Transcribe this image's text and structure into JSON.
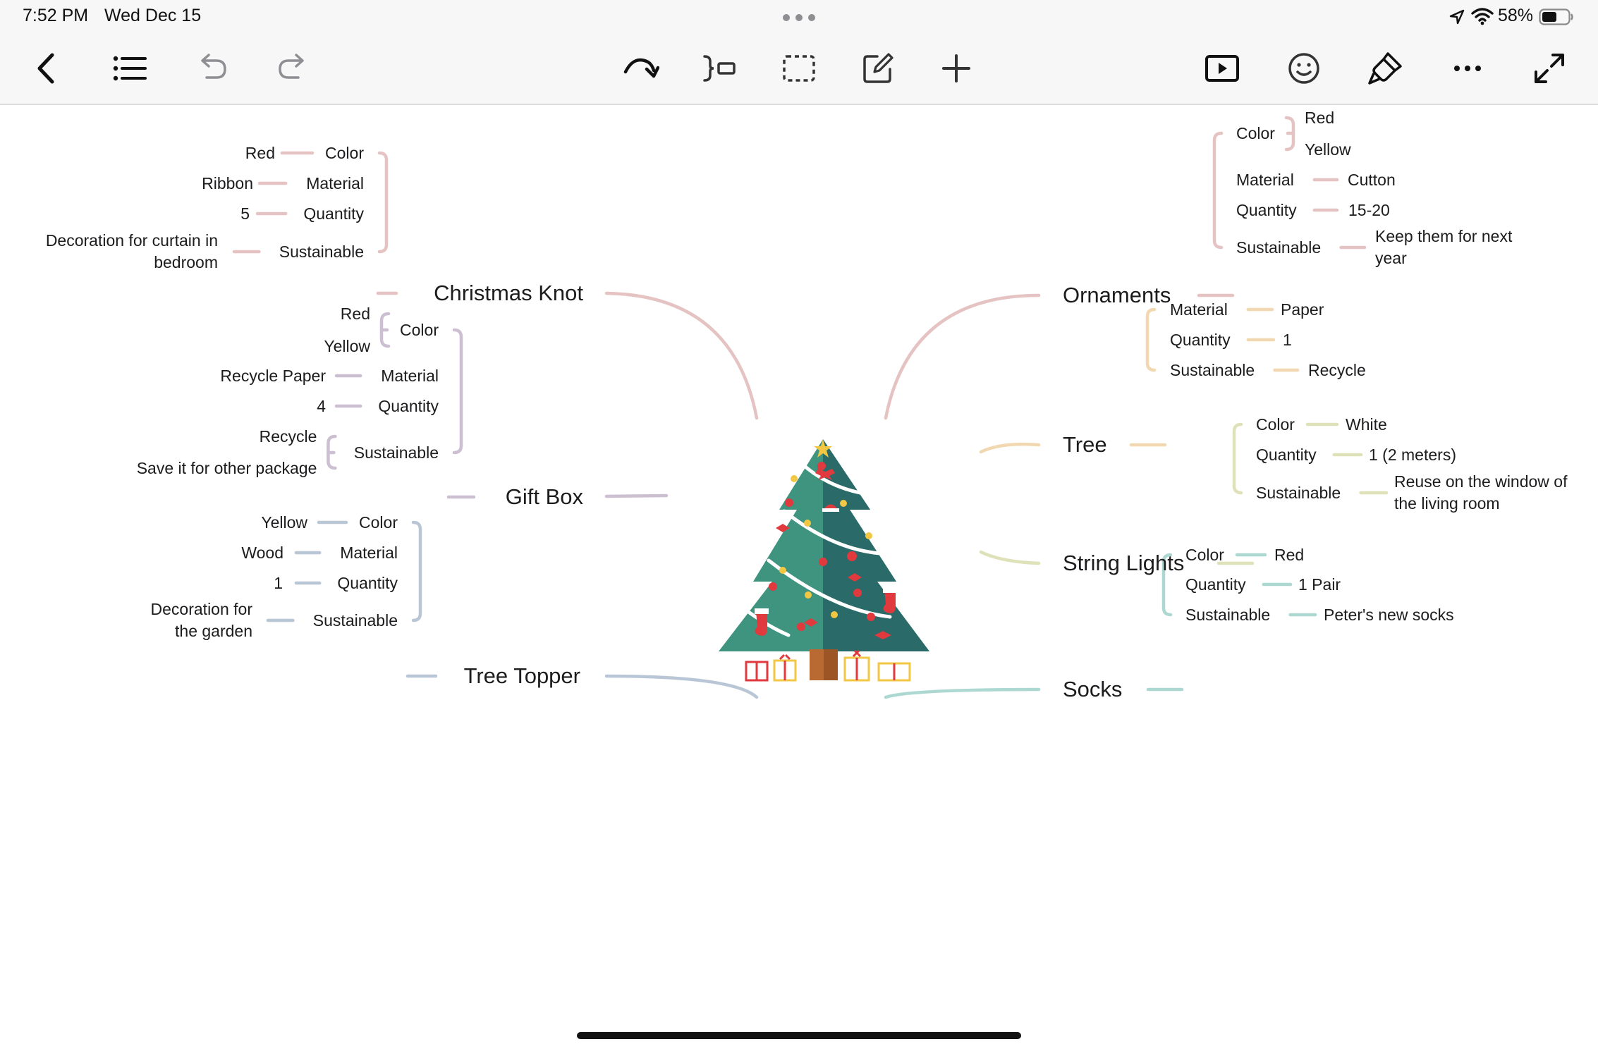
{
  "status_bar": {
    "time": "7:52 PM",
    "date": "Wed Dec 15",
    "battery": "58%",
    "battery_level": 0.58
  },
  "toolbar": {
    "left": [
      {
        "name": "back-button",
        "icon": "chevron-left-icon"
      },
      {
        "name": "outline-button",
        "icon": "list-icon"
      },
      {
        "name": "undo-button",
        "icon": "undo-icon"
      },
      {
        "name": "redo-button",
        "icon": "redo-icon"
      }
    ],
    "center": [
      {
        "name": "relationship-button",
        "icon": "curved-arrow-icon"
      },
      {
        "name": "summary-button",
        "icon": "summary-bracket-icon"
      },
      {
        "name": "boundary-button",
        "icon": "dashed-rect-icon"
      },
      {
        "name": "note-button",
        "icon": "edit-note-icon"
      },
      {
        "name": "add-topic-button",
        "icon": "plus-icon"
      }
    ],
    "right": [
      {
        "name": "play-button",
        "icon": "play-icon"
      },
      {
        "name": "sticker-button",
        "icon": "smiley-icon"
      },
      {
        "name": "format-button",
        "icon": "brush-icon"
      },
      {
        "name": "more-button",
        "icon": "more-icon"
      },
      {
        "name": "fullscreen-button",
        "icon": "expand-icon"
      }
    ]
  },
  "colors": {
    "christmas_knot": "#e5c3c3",
    "gift_box": "#cdbfd2",
    "tree_topper": "#b9c6d6",
    "ornaments": "#e5c3c3",
    "tree": "#f1d8b0",
    "string_lights": "#dfe2b9",
    "socks": "#add8d1"
  },
  "mindmap": {
    "central_image": "christmas-tree-image",
    "branches": {
      "christmas_knot": {
        "label": "Christmas Knot",
        "attributes": [
          {
            "key": "Color",
            "values": [
              "Red"
            ]
          },
          {
            "key": "Material",
            "values": [
              "Ribbon"
            ]
          },
          {
            "key": "Quantity",
            "values": [
              "5"
            ]
          },
          {
            "key": "Sustainable",
            "values": [
              "Decoration for curtain in bedroom"
            ]
          }
        ]
      },
      "gift_box": {
        "label": "Gift Box",
        "attributes": [
          {
            "key": "Color",
            "values": [
              "Red",
              "Yellow"
            ]
          },
          {
            "key": "Material",
            "values": [
              "Recycle Paper"
            ]
          },
          {
            "key": "Quantity",
            "values": [
              "4"
            ]
          },
          {
            "key": "Sustainable",
            "values": [
              "Recycle",
              "Save it for other package"
            ]
          }
        ]
      },
      "tree_topper": {
        "label": "Tree Topper",
        "attributes": [
          {
            "key": "Color",
            "values": [
              "Yellow"
            ]
          },
          {
            "key": "Material",
            "values": [
              "Wood"
            ]
          },
          {
            "key": "Quantity",
            "values": [
              "1"
            ]
          },
          {
            "key": "Sustainable",
            "values": [
              "Decoration for the garden"
            ]
          }
        ]
      },
      "ornaments": {
        "label": "Ornaments",
        "attributes": [
          {
            "key": "Color",
            "values": [
              "Red",
              "Yellow"
            ]
          },
          {
            "key": "Material",
            "values": [
              "Cutton"
            ]
          },
          {
            "key": "Quantity",
            "values": [
              "15-20"
            ]
          },
          {
            "key": "Sustainable",
            "values": [
              "Keep them for next year"
            ]
          }
        ]
      },
      "tree": {
        "label": "Tree",
        "attributes": [
          {
            "key": "Material",
            "values": [
              "Paper"
            ]
          },
          {
            "key": "Quantity",
            "values": [
              "1"
            ]
          },
          {
            "key": "Sustainable",
            "values": [
              "Recycle"
            ]
          }
        ]
      },
      "string_lights": {
        "label": "String Lights",
        "attributes": [
          {
            "key": "Color",
            "values": [
              "White"
            ]
          },
          {
            "key": "Quantity",
            "values": [
              "1 (2 meters)"
            ]
          },
          {
            "key": "Sustainable",
            "values": [
              "Reuse on the window of the living room"
            ]
          }
        ]
      },
      "socks": {
        "label": "Socks",
        "attributes": [
          {
            "key": "Color",
            "values": [
              "Red"
            ]
          },
          {
            "key": "Quantity",
            "values": [
              "1 Pair"
            ]
          },
          {
            "key": "Sustainable",
            "values": [
              "Peter's new socks"
            ]
          }
        ]
      }
    }
  }
}
